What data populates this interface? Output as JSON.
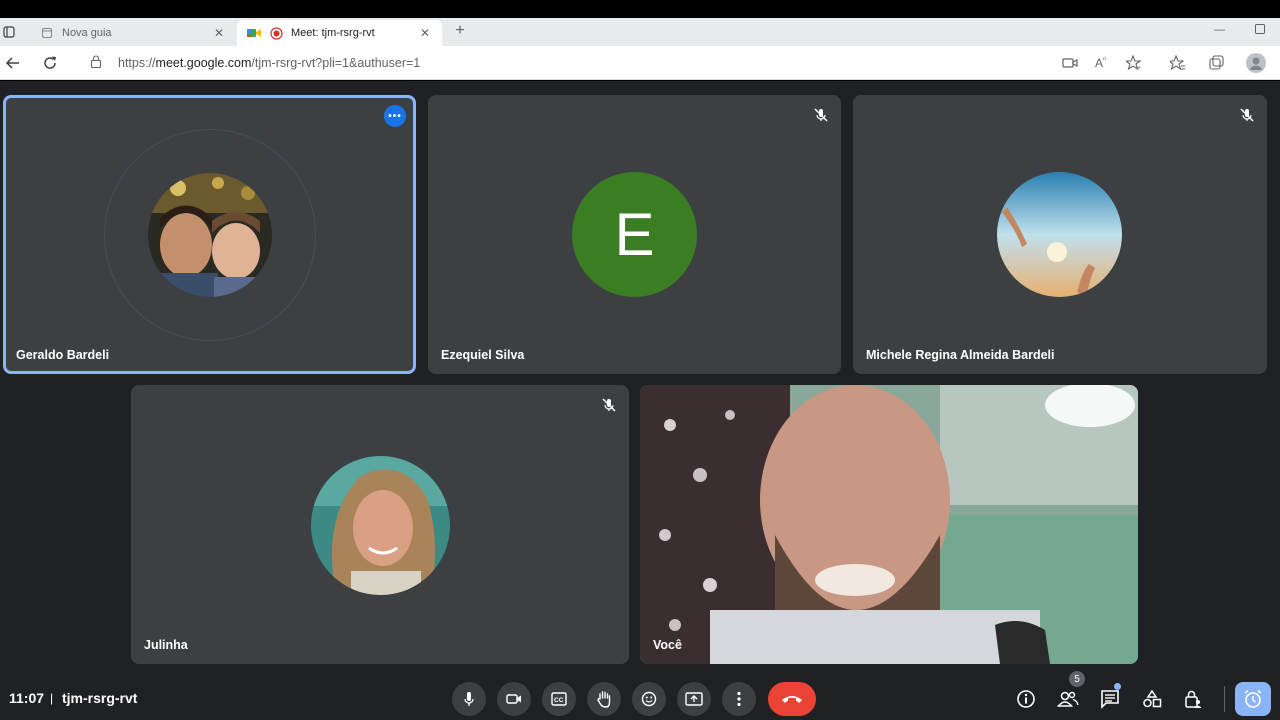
{
  "browser": {
    "tabs": [
      {
        "label": "Nova guia",
        "icon": "page-icon"
      },
      {
        "label": "Meet: tjm-rsrg-rvt",
        "icon": "meet-icon"
      }
    ],
    "url_proto": "https://",
    "url_host": "meet.google.com",
    "url_path": "/tjm-rsrg-rvt?pli=1&authuser=1"
  },
  "participants": [
    {
      "name": "Geraldo Bardeli",
      "speaking": true,
      "muted": false
    },
    {
      "name": "Ezequiel Silva",
      "initial": "E",
      "avatar_color": "#3b7d23",
      "muted": true
    },
    {
      "name": "Michele Regina Almeida Bardeli",
      "muted": true
    },
    {
      "name": "Julinha",
      "muted": true
    },
    {
      "name": "Você",
      "muted": false
    }
  ],
  "bottom": {
    "time": "11:07",
    "separator": "|",
    "meeting_code": "tjm-rsrg-rvt",
    "participant_count": "5"
  },
  "colors": {
    "background": "#202124",
    "tile": "#3c4043",
    "end_call": "#ea4335",
    "accent": "#8ab4f8"
  }
}
